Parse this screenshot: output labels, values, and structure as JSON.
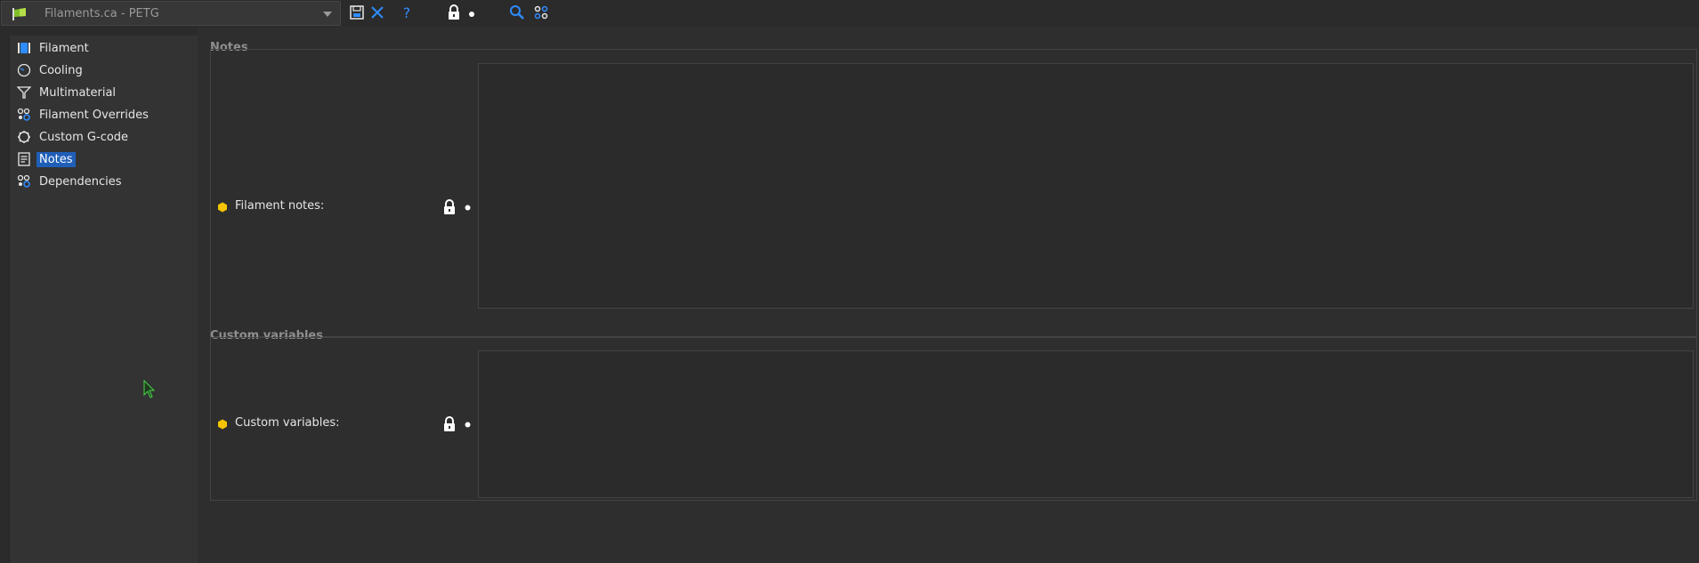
{
  "toolbar": {
    "preset_name": "Filaments.ca - PETG",
    "icons": [
      "flag-icon",
      "dropdown-arrow-icon",
      "save-icon",
      "delete-icon",
      "help-icon",
      "lock-icon",
      "dot-icon",
      "search-icon",
      "compare-icon"
    ]
  },
  "sidebar": {
    "items": [
      {
        "label": "Filament",
        "icon": "filament-icon"
      },
      {
        "label": "Cooling",
        "icon": "cooling-icon"
      },
      {
        "label": "Multimaterial",
        "icon": "multimaterial-icon"
      },
      {
        "label": "Filament Overrides",
        "icon": "overrides-icon"
      },
      {
        "label": "Custom G-code",
        "icon": "gcode-icon"
      },
      {
        "label": "Notes",
        "icon": "notes-icon",
        "selected": true
      },
      {
        "label": "Dependencies",
        "icon": "dependencies-icon"
      }
    ]
  },
  "main": {
    "groups": [
      {
        "title": "Notes",
        "option_label": "Filament notes:",
        "value": ""
      },
      {
        "title": "Custom variables",
        "option_label": "Custom variables:",
        "value": ""
      }
    ]
  },
  "colors": {
    "background": "#2b2b2b",
    "selection": "#1f5fb8",
    "accent_blue": "#2f8cff",
    "bullet_yellow": "#f5c400",
    "flag_green": "#7fbf2a"
  }
}
